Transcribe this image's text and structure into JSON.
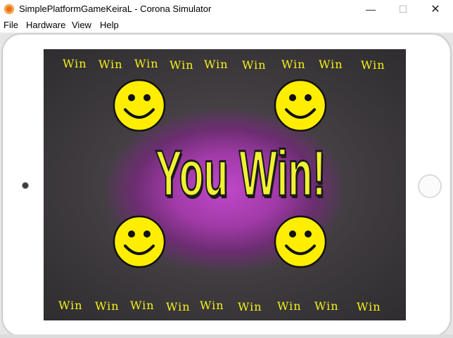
{
  "window": {
    "title": "SimplePlatformGameKeiraL - Corona Simulator",
    "controls": {
      "minimize": "—",
      "maximize": "☐",
      "close": "✕"
    }
  },
  "menu": {
    "items": [
      "File",
      "Hardware",
      "View",
      "Help"
    ]
  },
  "game": {
    "headline": "You Win!",
    "top_labels": [
      "Win",
      "Win",
      "Win",
      "Win",
      "Win",
      "Win",
      "Win",
      "Win",
      "Win"
    ],
    "bottom_labels": [
      "Win",
      "Win",
      "Win",
      "Win",
      "Win",
      "Win",
      "Win",
      "Win",
      "Win"
    ],
    "icons": [
      "smiley-face-icon",
      "smiley-face-icon",
      "smiley-face-icon",
      "smiley-face-icon"
    ]
  },
  "colors": {
    "win_text": "#f2f21a",
    "headline": "#f0f232",
    "smiley": "#ffee00",
    "background_center": "#c048c8"
  }
}
